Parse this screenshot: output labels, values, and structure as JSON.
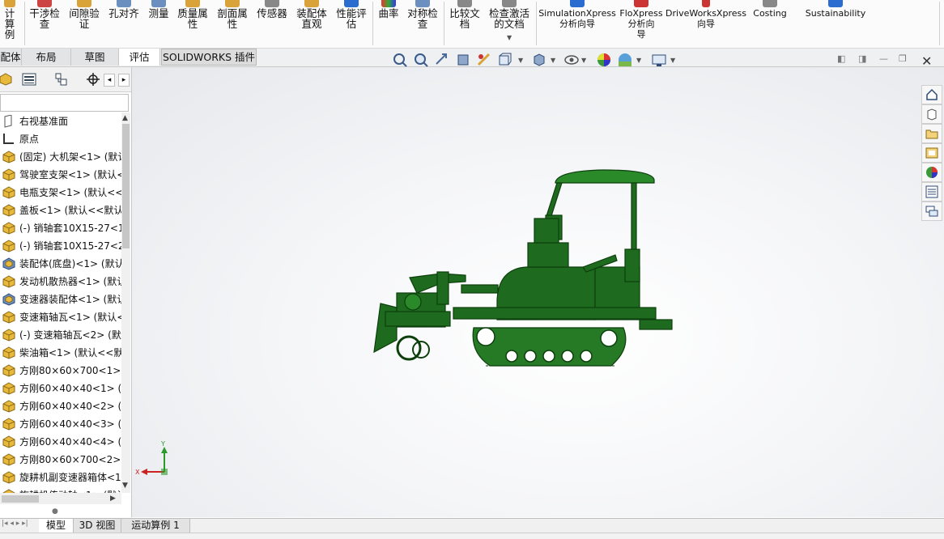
{
  "ribbon": {
    "items": [
      {
        "label": "计算\n例"
      },
      {
        "label": "干涉检\n查"
      },
      {
        "label": "间隙验\n证"
      },
      {
        "label": "孔对齐"
      },
      {
        "label": "测量"
      },
      {
        "label": "质量属\n性"
      },
      {
        "label": "剖面属\n性"
      },
      {
        "label": "传感器"
      },
      {
        "label": "装配体\n直观"
      },
      {
        "label": "性能评\n估"
      },
      {
        "label": "曲率"
      },
      {
        "label": "对称检\n查"
      },
      {
        "label": "比较文\n档"
      },
      {
        "label": "检查激活\n的文档"
      },
      {
        "label": "SimulationXpress\n分析向导"
      },
      {
        "label": "FloXpress\n分析向\n导"
      },
      {
        "label": "DriveWorksXpress\n向导"
      },
      {
        "label": "Costing"
      },
      {
        "label": "Sustainability"
      }
    ]
  },
  "command_tabs": [
    {
      "label": "配体"
    },
    {
      "label": "布局"
    },
    {
      "label": "草图"
    },
    {
      "label": "评估"
    },
    {
      "label": "SOLIDWORKS 插件"
    }
  ],
  "feature_tree": {
    "nodes": [
      {
        "label": "右视基准面",
        "icon": "plane-icon"
      },
      {
        "label": "原点",
        "icon": "origin-icon"
      },
      {
        "label": "(固定) 大机架<1> (默认",
        "icon": "part-icon"
      },
      {
        "label": "驾驶室支架<1> (默认<",
        "icon": "part-icon"
      },
      {
        "label": "电瓶支架<1> (默认<<",
        "icon": "part-icon"
      },
      {
        "label": "盖板<1> (默认<<默认",
        "icon": "part-icon"
      },
      {
        "label": "(-) 销轴套10X15-27<1",
        "icon": "part-icon"
      },
      {
        "label": "(-) 销轴套10X15-27<2",
        "icon": "part-icon"
      },
      {
        "label": "装配体(底盘)<1> (默认",
        "icon": "assembly-icon"
      },
      {
        "label": "发动机散热器<1> (默认",
        "icon": "part-icon"
      },
      {
        "label": "变速器装配体<1> (默认",
        "icon": "assembly-icon"
      },
      {
        "label": "变速箱轴瓦<1> (默认<",
        "icon": "part-icon"
      },
      {
        "label": "(-) 变速箱轴瓦<2> (默",
        "icon": "part-icon"
      },
      {
        "label": "柴油箱<1> (默认<<默",
        "icon": "part-icon"
      },
      {
        "label": "方刚80×60×700<1> (",
        "icon": "part-icon"
      },
      {
        "label": "方刚60×40×40<1> (默",
        "icon": "part-icon"
      },
      {
        "label": "方刚60×40×40<2> (默",
        "icon": "part-icon"
      },
      {
        "label": "方刚60×40×40<3> (默",
        "icon": "part-icon"
      },
      {
        "label": "方刚60×40×40<4> (默",
        "icon": "part-icon"
      },
      {
        "label": "方刚80×60×700<2> (",
        "icon": "part-icon"
      },
      {
        "label": "旋耕机副变速器箱体<1",
        "icon": "part-icon"
      },
      {
        "label": "旋耕机传动轴<1> (默认",
        "icon": "part-icon"
      }
    ]
  },
  "triad": {
    "x_label": "X",
    "y_label": "Y"
  },
  "bottom_tabs": [
    {
      "label": "模型"
    },
    {
      "label": "3D 视图"
    },
    {
      "label": "运动算例 1"
    }
  ],
  "colors": {
    "model_green": "#1e6a1e",
    "accent": "#2a6ccf"
  }
}
